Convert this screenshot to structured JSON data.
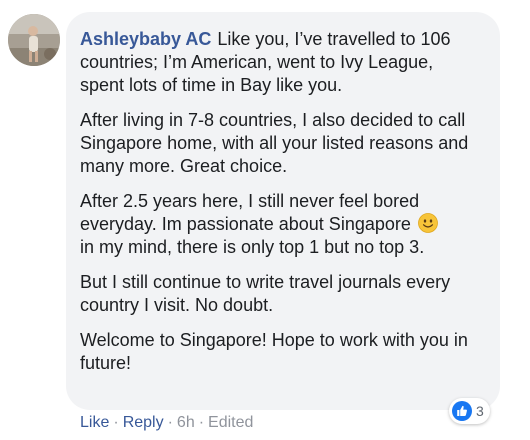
{
  "comment": {
    "author": "Ashleybaby AC",
    "paragraphs": [
      "Like you, I’ve travelled to 106 countries; I’m American, went to Ivy League, spent lots of time in Bay like you.",
      "After living in 7-8 countries, I also decided to call Singapore home, with all your listed reasons and many more. Great choice.",
      "After 2.5 years here, I still never feel bored everyday. Im passionate about Singapore",
      "in my mind, there is only top 1 but no top 3.",
      "But I still continue to write travel journals every country I visit. No doubt.",
      "Welcome to Singapore! Hope to work with you in future!"
    ],
    "emoji": "slightly-smiling-face-icon",
    "reactions": {
      "type": "like-icon",
      "count": "3",
      "color": "#1877f2"
    }
  },
  "actions": {
    "like": "Like",
    "reply": "Reply",
    "time": "6h",
    "edited": "Edited",
    "separator": "·"
  },
  "colors": {
    "author": "#385898",
    "bubble": "#f2f3f5",
    "muted": "#90949c"
  }
}
